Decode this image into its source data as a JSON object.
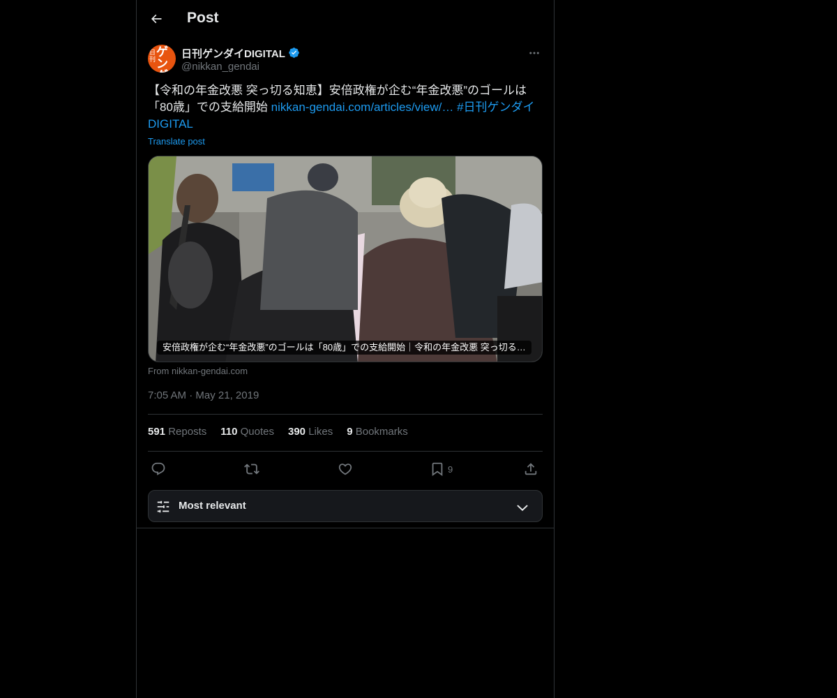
{
  "header": {
    "title": "Post"
  },
  "author": {
    "display_name": "日刊ゲンダイDIGITAL",
    "handle": "@nikkan_gendai",
    "verified": true
  },
  "tweet": {
    "text": "【令和の年金改悪 突っ切る知恵】安倍政権が企む“年金改悪”のゴールは「80歳」での支給開始 ",
    "link": "nikkan-gendai.com/articles/view/…",
    "hashtag": "#日刊ゲンダイDIGITAL",
    "translate_label": "Translate post"
  },
  "card": {
    "caption": "安倍政権が企む“年金改悪”のゴールは「80歳」での支給開始｜令和の年金改悪 突っ切る…",
    "source": "From nikkan-gendai.com"
  },
  "meta": {
    "time": "7:05 AM",
    "separator": "·",
    "date": "May 21, 2019"
  },
  "stats": {
    "reposts": {
      "count": "591",
      "label": "Reposts"
    },
    "quotes": {
      "count": "110",
      "label": "Quotes"
    },
    "likes": {
      "count": "390",
      "label": "Likes"
    },
    "bookmarks": {
      "count": "9",
      "label": "Bookmarks"
    }
  },
  "actions": {
    "bookmark_count": "9"
  },
  "sort": {
    "label": "Most relevant"
  },
  "colors": {
    "background": "#000000",
    "accent": "#1d9bf0",
    "secondary_text": "#71767b",
    "border": "#2f3336"
  },
  "icons": [
    "back-arrow-icon",
    "verified-badge-icon",
    "more-icon",
    "reply-icon",
    "repost-icon",
    "like-icon",
    "bookmark-icon",
    "share-icon",
    "sliders-icon",
    "chevron-down-icon"
  ]
}
